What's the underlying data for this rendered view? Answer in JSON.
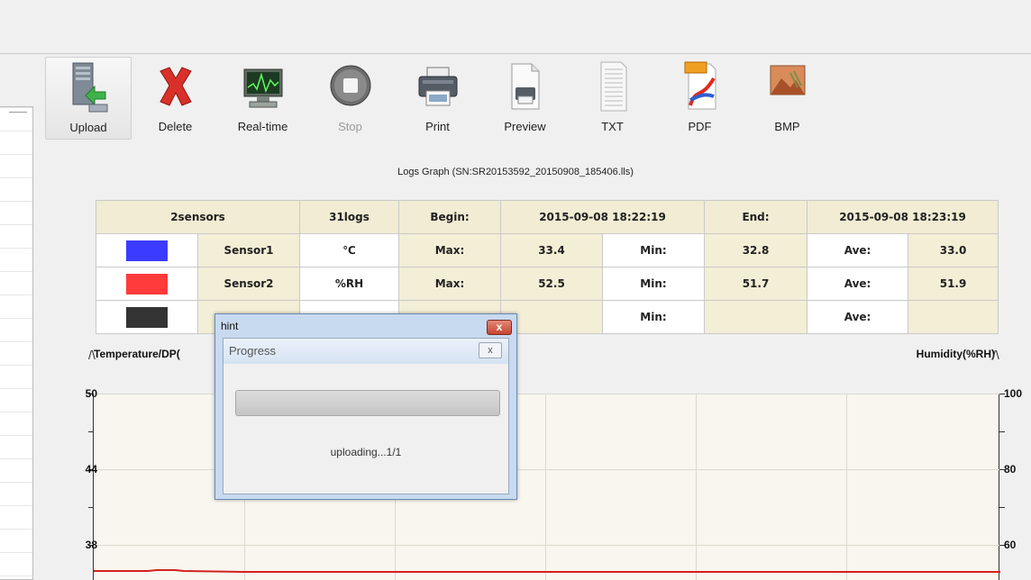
{
  "toolbar": {
    "buttons": [
      {
        "label": "Upload",
        "icon": "upload-icon"
      },
      {
        "label": "Delete",
        "icon": "delete-icon"
      },
      {
        "label": "Real-time",
        "icon": "realtime-icon"
      },
      {
        "label": "Stop",
        "icon": "stop-icon"
      },
      {
        "label": "Print",
        "icon": "print-icon"
      },
      {
        "label": "Preview",
        "icon": "preview-icon"
      },
      {
        "label": "TXT",
        "icon": "txt-icon"
      },
      {
        "label": "PDF",
        "icon": "pdf-icon"
      },
      {
        "label": "BMP",
        "icon": "bmp-icon"
      }
    ]
  },
  "logs_title": "Logs Graph (SN:SR20153592_20150908_185406.lls)",
  "summary": {
    "sensors_count": "2sensors",
    "logs_count": "31logs",
    "begin_label": "Begin:",
    "begin_value": "2015-09-08 18:22:19",
    "end_label": "End:",
    "end_value": "2015-09-08 18:23:19"
  },
  "rows": [
    {
      "color": "#3b3bff",
      "name": "Sensor1",
      "unit": "℃",
      "max_label": "Max:",
      "max": "33.4",
      "min_label": "Min:",
      "min": "32.8",
      "ave_label": "Ave:",
      "ave": "33.0"
    },
    {
      "color": "#ff3b3b",
      "name": "Sensor2",
      "unit": "%RH",
      "max_label": "Max:",
      "max": "52.5",
      "min_label": "Min:",
      "min": "51.7",
      "ave_label": "Ave:",
      "ave": "51.9"
    },
    {
      "color": "#333333",
      "name": "",
      "unit": "",
      "max_label": "",
      "max": "",
      "min_label": "Min:",
      "min": "",
      "ave_label": "Ave:",
      "ave": ""
    }
  ],
  "graph": {
    "left_axis_title": "Temperature/DP(",
    "right_axis_title": "Humidity(%RH)",
    "left_ticks": [
      "50",
      "44",
      "38"
    ],
    "right_ticks": [
      "100",
      "80",
      "60"
    ],
    "line_color": "#d42020"
  },
  "dialog": {
    "title": "hint",
    "close_glyph": "x",
    "inner_title": "Progress",
    "inner_close_glyph": "x",
    "status": "uploading...1/1",
    "progress_fraction": 1.0
  }
}
